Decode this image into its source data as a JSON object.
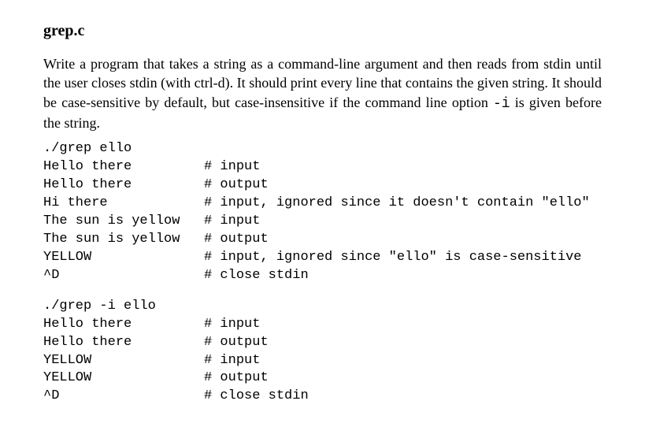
{
  "heading": "grep.c",
  "body_text": "Write a program that takes a string as a command-line argument and then reads from stdin until the user closes stdin (with ctrl-d). It should print every line that contains the given string. It should be case-sensitive by default, but case-insensitive if the command line option -i is given before the string.",
  "inline_code_option": "-i",
  "examples": [
    {
      "lines": [
        {
          "text": "./grep ello",
          "comment": ""
        },
        {
          "text": "Hello there",
          "comment": "# input"
        },
        {
          "text": "Hello there",
          "comment": "# output"
        },
        {
          "text": "Hi there",
          "comment": "# input, ignored since it doesn't contain \"ello\""
        },
        {
          "text": "The sun is yellow",
          "comment": "# input"
        },
        {
          "text": "The sun is yellow",
          "comment": "# output"
        },
        {
          "text": "YELLOW",
          "comment": "# input, ignored since \"ello\" is case-sensitive"
        },
        {
          "text": "^D",
          "comment": "# close stdin"
        }
      ]
    },
    {
      "lines": [
        {
          "text": "./grep -i ello",
          "comment": ""
        },
        {
          "text": "Hello there",
          "comment": "# input"
        },
        {
          "text": "Hello there",
          "comment": "# output"
        },
        {
          "text": "YELLOW",
          "comment": "# input"
        },
        {
          "text": "YELLOW",
          "comment": "# output"
        },
        {
          "text": "^D",
          "comment": "# close stdin"
        }
      ]
    }
  ],
  "layout": {
    "code_text_column_width": 20
  }
}
